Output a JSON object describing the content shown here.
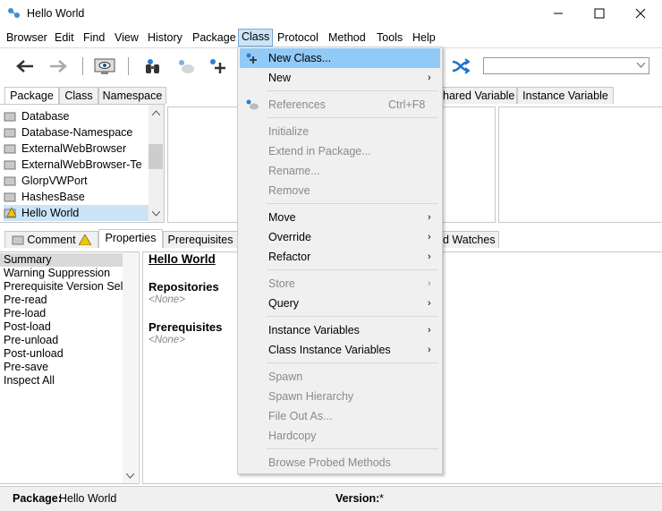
{
  "window": {
    "title": "Hello World"
  },
  "menubar": [
    "Browser",
    "Edit",
    "Find",
    "View",
    "History",
    "Package",
    "Class",
    "Protocol",
    "Method",
    "Tools",
    "Help"
  ],
  "top_tabs": {
    "package": "Package",
    "class": "Class",
    "namespace": "Namespace",
    "shared": "hared Variable",
    "instance": "Instance Variable"
  },
  "packages": [
    "Database",
    "Database-Namespace",
    "ExternalWebBrowser",
    "ExternalWebBrowser-Te",
    "GlorpVWPort",
    "HashesBase",
    "Hello World"
  ],
  "selected_package": "Hello World",
  "bottom_tabs": {
    "comment": "Comment",
    "properties": "Properties",
    "prerequisites": "Prerequisites",
    "watches": "d Watches"
  },
  "summary_items": [
    "Summary",
    "Warning Suppression",
    "Prerequisite Version Selec",
    "Pre-read",
    "Pre-load",
    "Post-load",
    "Pre-unload",
    "Post-unload",
    "Pre-save",
    "Inspect All"
  ],
  "details": {
    "title": "Hello World",
    "repositories": "Repositories",
    "repositories_value": "<None>",
    "prerequisites": "Prerequisites",
    "prerequisites_value": "<None>"
  },
  "status": {
    "package_label": "Package:",
    "package_value": "Hello World",
    "version_label": "Version:",
    "version_value": "*"
  },
  "class_menu": {
    "new_class": "New Class...",
    "new": "New",
    "references": "References",
    "references_shortcut": "Ctrl+F8",
    "initialize": "Initialize",
    "extend": "Extend in Package...",
    "rename": "Rename...",
    "remove": "Remove",
    "move": "Move",
    "override": "Override",
    "refactor": "Refactor",
    "store": "Store",
    "query": "Query",
    "instance_vars": "Instance Variables",
    "class_instance_vars": "Class Instance Variables",
    "spawn": "Spawn",
    "spawn_hierarchy": "Spawn Hierarchy",
    "file_out": "File Out As...",
    "hardcopy": "Hardcopy",
    "browse_probed": "Browse Probed Methods"
  },
  "colors": {
    "selection": "#cce4f7",
    "highlight": "#91c9f7",
    "menu_bg": "#f0f0f0",
    "accent": "#1a73c8"
  }
}
